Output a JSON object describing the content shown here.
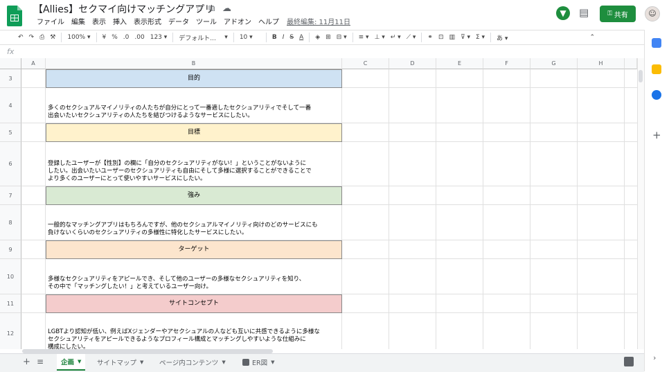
{
  "header": {
    "title": "【Allies】セクマイ向けマッチングアプリ",
    "menu": [
      "ファイル",
      "編集",
      "表示",
      "挿入",
      "表示形式",
      "データ",
      "ツール",
      "アドオン",
      "ヘルプ"
    ],
    "last_edit": "最終編集: 11月11日",
    "share_label": "共有"
  },
  "toolbar": {
    "zoom": "100%",
    "currency": "¥",
    "percent": "%",
    "dec_less": ".0",
    "dec_more": ".00",
    "format_more": "123",
    "font": "デフォルト...",
    "font_size": "10",
    "ime": "あ"
  },
  "formula_bar": {
    "fx": "fx",
    "value": ""
  },
  "columns": [
    "A",
    "B",
    "C",
    "D",
    "E",
    "F",
    "G",
    "H"
  ],
  "rows": [
    {
      "num": "3",
      "type": "header",
      "text": "目的",
      "color": "#cfe2f3"
    },
    {
      "num": "4",
      "type": "body",
      "text": "多くのセクシュアルマイノリティの人たちが自分にとって一番適したセクシュアリティでそして一番\n出会いたいセクシュアリティの人たちを結びつけるようなサービスにしたい。"
    },
    {
      "num": "5",
      "type": "header",
      "text": "目標",
      "color": "#fff2cc"
    },
    {
      "num": "6",
      "type": "body",
      "text": "登録したユーザーが【性別】の欄に「自分のセクシュアリティがない！」ということがないように\nしたい。出会いたいユーザーのセクシュアリティも自由にそして多様に選択することができることで\nより多くのユーザーにとって使いやすいサービスにしたい。"
    },
    {
      "num": "7",
      "type": "header",
      "text": "強み",
      "color": "#d9ead3"
    },
    {
      "num": "8",
      "type": "body",
      "text": "一般的なマッチングアプリはもちろんですが、他のセクシュアルマイノリティ向けのどのサービスにも\n負けないくらいのセクシュアリティの多様性に特化したサービスにしたい。"
    },
    {
      "num": "9",
      "type": "header",
      "text": "ターゲット",
      "color": "#fce5cd"
    },
    {
      "num": "10",
      "type": "body",
      "text": "多様なセクシュアリティをアピールでき、そして他のユーザーの多様なセクシュアリティを知り、\nその中で「マッチングしたい！」と考えているユーザー向け。"
    },
    {
      "num": "11",
      "type": "header",
      "text": "サイトコンセプト",
      "color": "#f4cccc"
    },
    {
      "num": "12",
      "type": "body",
      "text": "LGBTより認知が低い、例えばXジェンダーやアセクシュアルの人なども互いに共感できるように多様な\nセクシュアリティをアピールできるようなプロフィール構成とマッチングしやすいような仕組みに\n構成にしたい。"
    }
  ],
  "sheet_tabs": [
    {
      "label": "企画",
      "active": true
    },
    {
      "label": "サイトマップ",
      "active": false
    },
    {
      "label": "ページ内コンテンツ",
      "active": false
    },
    {
      "label": "ER図",
      "active": false
    }
  ]
}
